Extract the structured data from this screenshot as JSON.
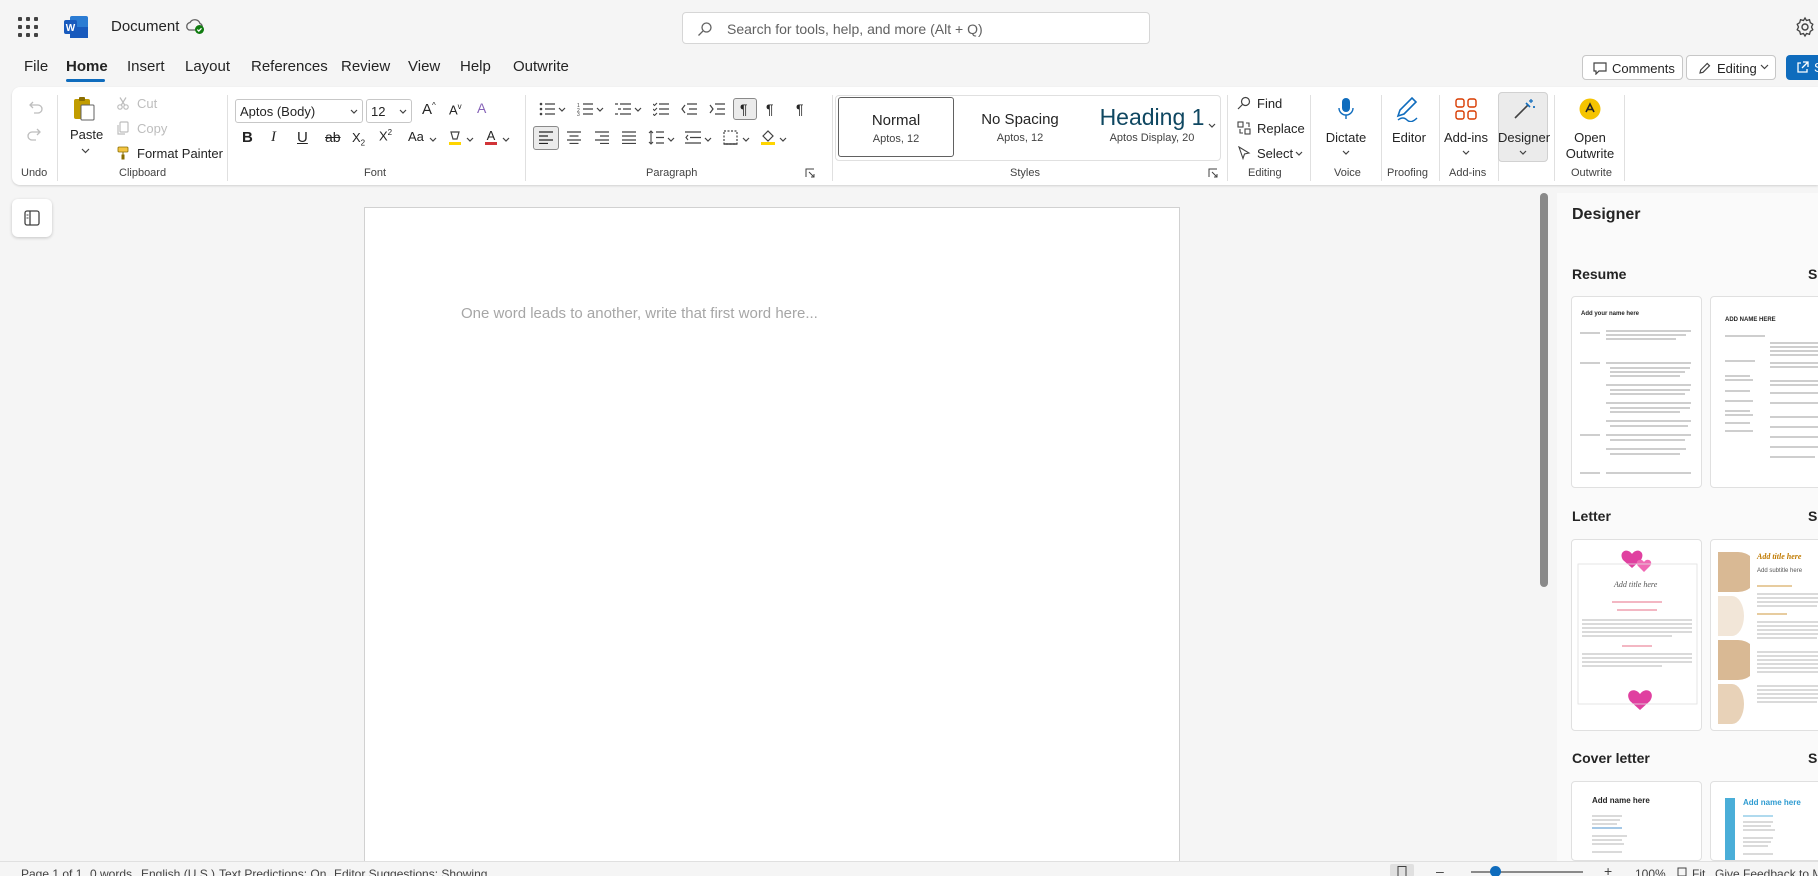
{
  "app": {
    "doc_title": "Document",
    "search_placeholder": "Search for tools, help, and more (Alt + Q)"
  },
  "tabs": [
    "File",
    "Home",
    "Insert",
    "Layout",
    "References",
    "Review",
    "View",
    "Help",
    "Outwrite"
  ],
  "header_buttons": {
    "comments": "Comments",
    "editing": "Editing",
    "share": "S"
  },
  "ribbon": {
    "undo": {
      "group": "Undo"
    },
    "clipboard": {
      "group": "Clipboard",
      "paste": "Paste",
      "cut": "Cut",
      "copy": "Copy",
      "format_painter": "Format Painter"
    },
    "font": {
      "group": "Font",
      "font_name": "Aptos (Body)",
      "font_size": "12"
    },
    "paragraph": {
      "group": "Paragraph"
    },
    "styles": {
      "group": "Styles",
      "items": [
        {
          "name": "Normal",
          "sub": "Aptos, 12"
        },
        {
          "name": "No Spacing",
          "sub": "Aptos, 12"
        },
        {
          "name": "Heading 1",
          "sub": "Aptos Display, 20"
        }
      ]
    },
    "editing": {
      "group": "Editing",
      "find": "Find",
      "replace": "Replace",
      "select": "Select"
    },
    "voice": {
      "group": "Voice",
      "dictate": "Dictate"
    },
    "proofing": {
      "group": "Proofing",
      "editor": "Editor"
    },
    "addins": {
      "group": "Add-ins",
      "addins": "Add-ins"
    },
    "designer": {
      "designer": "Designer"
    },
    "outwrite": {
      "group": "Outwrite",
      "open_l1": "Open",
      "open_l2": "Outwrite"
    }
  },
  "document": {
    "placeholder": "One word leads to another, write that first word here..."
  },
  "designer_pane": {
    "title": "Designer",
    "sections": [
      {
        "name": "Resume",
        "more": "Sh"
      },
      {
        "name": "Letter",
        "more": "Sh"
      },
      {
        "name": "Cover letter",
        "more": "Sh"
      }
    ],
    "thumb_text": {
      "resume1_name": "Add your name here",
      "resume2_name": "ADD NAME HERE",
      "letter1_title": "Add title here",
      "letter2_title": "Add title here",
      "letter2_sub": "Add subtitle here",
      "cover1_name": "Add name here",
      "cover2_name": "Add name here"
    }
  },
  "status_bar": {
    "page": "Page 1 of 1",
    "words": "0 words",
    "language": "English (U.S.)",
    "predictions": "Text Predictions: On",
    "editor": "Editor Suggestions: Showing",
    "zoom": "100%",
    "fit": "Fit",
    "feedback": "Give Feedback to M"
  },
  "colors": {
    "accent": "#0f6cbd",
    "word_blue": "#185abd"
  }
}
